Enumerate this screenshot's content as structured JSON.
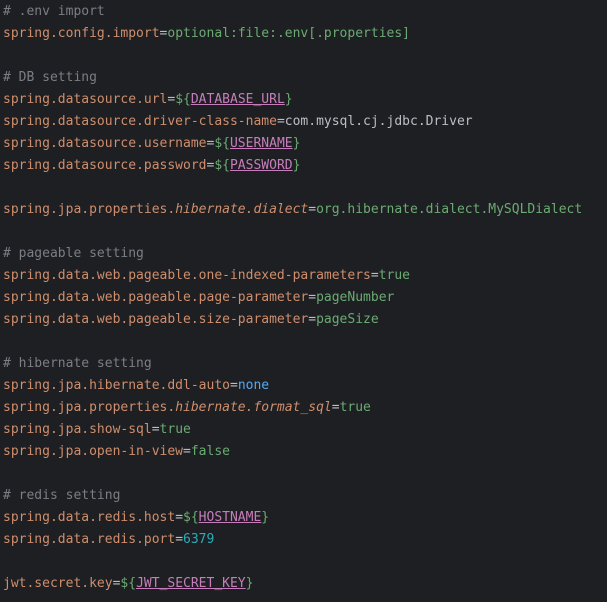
{
  "editor": {
    "file_lines": [
      {
        "segments": [
          {
            "t": "# .env import",
            "k": "comment"
          }
        ]
      },
      {
        "segments": [
          {
            "t": "spring.config.import",
            "k": "key"
          },
          {
            "t": "=",
            "k": "op"
          },
          {
            "t": "optional:file:.env[.properties]",
            "k": "value"
          }
        ]
      },
      {
        "segments": []
      },
      {
        "segments": [
          {
            "t": "# DB setting",
            "k": "comment"
          }
        ]
      },
      {
        "segments": [
          {
            "t": "spring.datasource.url",
            "k": "key"
          },
          {
            "t": "=",
            "k": "op"
          },
          {
            "t": "${",
            "k": "var-wrap"
          },
          {
            "t": "DATABASE_URL",
            "k": "var"
          },
          {
            "t": "}",
            "k": "var-wrap"
          }
        ]
      },
      {
        "segments": [
          {
            "t": "spring.datasource.driver-class-name",
            "k": "key"
          },
          {
            "t": "=",
            "k": "op"
          },
          {
            "t": "com.mysql.cj.jdbc.Driver",
            "k": "plain"
          }
        ]
      },
      {
        "segments": [
          {
            "t": "spring.datasource.username",
            "k": "key"
          },
          {
            "t": "=",
            "k": "op"
          },
          {
            "t": "${",
            "k": "var-wrap"
          },
          {
            "t": "USERNAME",
            "k": "var"
          },
          {
            "t": "}",
            "k": "var-wrap"
          }
        ]
      },
      {
        "segments": [
          {
            "t": "spring.datasource.password",
            "k": "key"
          },
          {
            "t": "=",
            "k": "op"
          },
          {
            "t": "${",
            "k": "var-wrap"
          },
          {
            "t": "PASSWORD",
            "k": "var"
          },
          {
            "t": "}",
            "k": "var-wrap"
          }
        ]
      },
      {
        "segments": []
      },
      {
        "segments": [
          {
            "t": "spring.jpa.properties.",
            "k": "key"
          },
          {
            "t": "hibernate.dialect",
            "k": "key-italic"
          },
          {
            "t": "=",
            "k": "op"
          },
          {
            "t": "org.hibernate.dialect.MySQLDialect",
            "k": "value"
          }
        ]
      },
      {
        "segments": []
      },
      {
        "segments": [
          {
            "t": "# pageable setting",
            "k": "comment"
          }
        ]
      },
      {
        "segments": [
          {
            "t": "spring.data.web.pageable.one-indexed-parameters",
            "k": "key"
          },
          {
            "t": "=",
            "k": "op"
          },
          {
            "t": "true",
            "k": "value"
          }
        ]
      },
      {
        "segments": [
          {
            "t": "spring.data.web.pageable.page-parameter",
            "k": "key"
          },
          {
            "t": "=",
            "k": "op"
          },
          {
            "t": "pageNumber",
            "k": "value"
          }
        ]
      },
      {
        "segments": [
          {
            "t": "spring.data.web.pageable.size-parameter",
            "k": "key"
          },
          {
            "t": "=",
            "k": "op"
          },
          {
            "t": "pageSize",
            "k": "value"
          }
        ]
      },
      {
        "segments": []
      },
      {
        "segments": [
          {
            "t": "# hibernate setting",
            "k": "comment"
          }
        ]
      },
      {
        "segments": [
          {
            "t": "spring.jpa.hibernate.ddl-auto",
            "k": "key"
          },
          {
            "t": "=",
            "k": "op"
          },
          {
            "t": "none",
            "k": "keyword"
          }
        ]
      },
      {
        "segments": [
          {
            "t": "spring.jpa.properties.",
            "k": "key"
          },
          {
            "t": "hibernate.format_sql",
            "k": "key-italic"
          },
          {
            "t": "=",
            "k": "op"
          },
          {
            "t": "true",
            "k": "value"
          }
        ]
      },
      {
        "segments": [
          {
            "t": "spring.jpa.show-sql",
            "k": "key"
          },
          {
            "t": "=",
            "k": "op"
          },
          {
            "t": "true",
            "k": "value"
          }
        ]
      },
      {
        "segments": [
          {
            "t": "spring.jpa.open-in-view",
            "k": "key"
          },
          {
            "t": "=",
            "k": "op"
          },
          {
            "t": "false",
            "k": "value"
          }
        ]
      },
      {
        "segments": []
      },
      {
        "segments": [
          {
            "t": "# redis setting",
            "k": "comment"
          }
        ]
      },
      {
        "segments": [
          {
            "t": "spring.data.redis.host",
            "k": "key"
          },
          {
            "t": "=",
            "k": "op"
          },
          {
            "t": "${",
            "k": "var-wrap"
          },
          {
            "t": "HOSTNAME",
            "k": "var"
          },
          {
            "t": "}",
            "k": "var-wrap"
          }
        ]
      },
      {
        "segments": [
          {
            "t": "spring.data.redis.port",
            "k": "key"
          },
          {
            "t": "=",
            "k": "op"
          },
          {
            "t": "6379",
            "k": "number"
          }
        ]
      },
      {
        "segments": []
      },
      {
        "segments": [
          {
            "t": "jwt.secret.key",
            "k": "key"
          },
          {
            "t": "=",
            "k": "op"
          },
          {
            "t": "${",
            "k": "var-wrap"
          },
          {
            "t": "JWT_SECRET_KEY",
            "k": "var"
          },
          {
            "t": "}",
            "k": "var-wrap"
          }
        ]
      }
    ]
  },
  "colors": {
    "background": "#1e1f22",
    "comment": "#7a7e85",
    "key": "#cf8e6d",
    "value": "#6aab73",
    "plain": "#bcbec4",
    "keyword": "#56a8f5",
    "number": "#2aacb8",
    "variable": "#c77dbb"
  }
}
